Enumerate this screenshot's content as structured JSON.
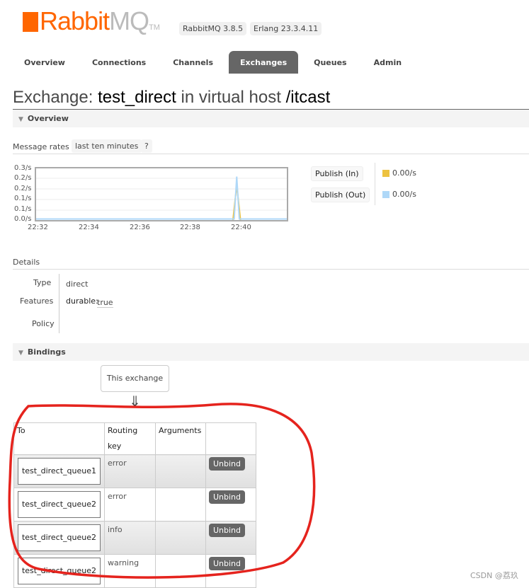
{
  "header": {
    "logo": {
      "part1": "Rabbit",
      "part2": "MQ",
      "tm": "TM"
    },
    "rabbitmq_version": "RabbitMQ 3.8.5",
    "erlang_version": "Erlang 23.3.4.11"
  },
  "nav": {
    "tabs": [
      {
        "label": "Overview"
      },
      {
        "label": "Connections"
      },
      {
        "label": "Channels"
      },
      {
        "label": "Exchanges",
        "active": true
      },
      {
        "label": "Queues"
      },
      {
        "label": "Admin"
      }
    ]
  },
  "page": {
    "prefix": "Exchange:",
    "name": "test_direct",
    "middle": "in virtual host",
    "vhost": "/itcast"
  },
  "overview": {
    "heading": "Overview",
    "rates_label": "Message rates",
    "range": "last ten minutes",
    "help": "?",
    "legend": [
      {
        "label": "Publish (In)",
        "value": "0.00/s",
        "color": "#edc240"
      },
      {
        "label": "Publish (Out)",
        "value": "0.00/s",
        "color": "#afd8f8"
      }
    ]
  },
  "chart_data": {
    "type": "line",
    "yticks": [
      "0.3/s",
      "0.2/s",
      "0.2/s",
      "0.1/s",
      "0.1/s",
      "0.0/s"
    ],
    "ylim": [
      0,
      0.3
    ],
    "xticks": [
      "22:32",
      "22:34",
      "22:36",
      "22:38",
      "22:40"
    ],
    "xlim_minutes": [
      0,
      9.83
    ],
    "series": [
      {
        "name": "Publish (In)",
        "color": "#edc240",
        "x": [
          0,
          7.7,
          7.85,
          8.0,
          9.83
        ],
        "y": [
          0,
          0,
          0.2,
          0,
          0
        ]
      },
      {
        "name": "Publish (Out)",
        "color": "#afd8f8",
        "x": [
          0,
          7.75,
          7.85,
          7.95,
          9.83
        ],
        "y": [
          0.01,
          0.01,
          0.25,
          0.01,
          0.01
        ]
      }
    ]
  },
  "details": {
    "heading": "Details",
    "rows": [
      {
        "label": "Type",
        "value": "direct"
      },
      {
        "label": "Features",
        "key": "durable:",
        "value": "true"
      },
      {
        "label": "Policy",
        "value": ""
      }
    ]
  },
  "bindings": {
    "heading": "Bindings",
    "source": "This exchange",
    "arrow": "⇓",
    "columns": [
      "To",
      "Routing key",
      "Arguments",
      ""
    ],
    "rows": [
      {
        "to": "test_direct_queue1",
        "key": "error",
        "action": "Unbind"
      },
      {
        "to": "test_direct_queue2",
        "key": "error",
        "action": "Unbind"
      },
      {
        "to": "test_direct_queue2",
        "key": "info",
        "action": "Unbind"
      },
      {
        "to": "test_direct_queue2",
        "key": "warning",
        "action": "Unbind"
      }
    ]
  },
  "watermark": "CSDN @荔玖"
}
